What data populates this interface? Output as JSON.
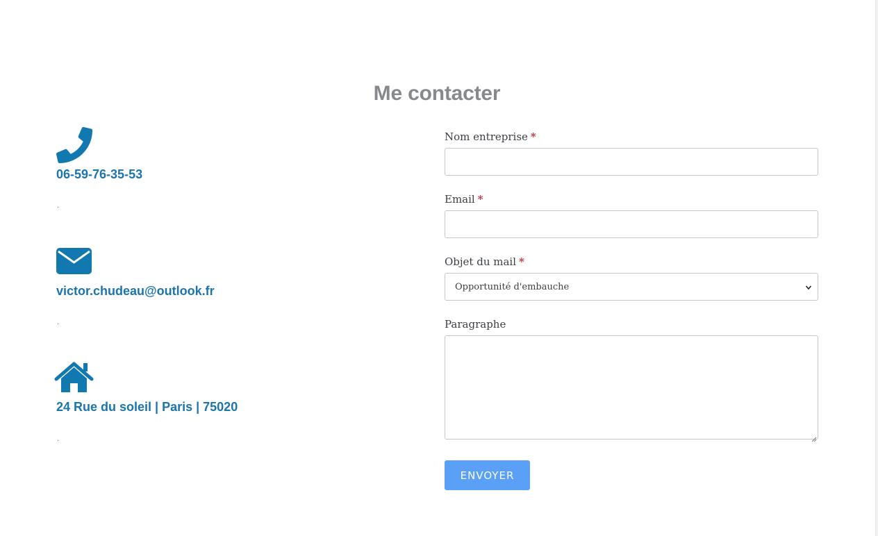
{
  "page": {
    "title": "Me contacter"
  },
  "contact": {
    "phone": {
      "icon": "phone-icon",
      "text": "06-59-76-35-53",
      "note": "."
    },
    "email": {
      "icon": "envelope-icon",
      "text": "victor.chudeau@outlook.fr",
      "note": "."
    },
    "address": {
      "icon": "home-icon",
      "text": "24 Rue du soleil | Paris | 75020",
      "note": "."
    }
  },
  "form": {
    "company": {
      "label": "Nom entreprise",
      "required": "*",
      "value": ""
    },
    "email": {
      "label": "Email",
      "required": "*",
      "value": ""
    },
    "subject": {
      "label": "Objet du mail",
      "required": "*",
      "selected": "Opportunité d'embauche"
    },
    "paragraph": {
      "label": "Paragraphe",
      "value": ""
    },
    "submit_label": "ENVOYER"
  },
  "colors": {
    "accent": "#1b74ac",
    "title": "#868a8c",
    "button": "#5aa0f7",
    "required": "#b8343b"
  }
}
